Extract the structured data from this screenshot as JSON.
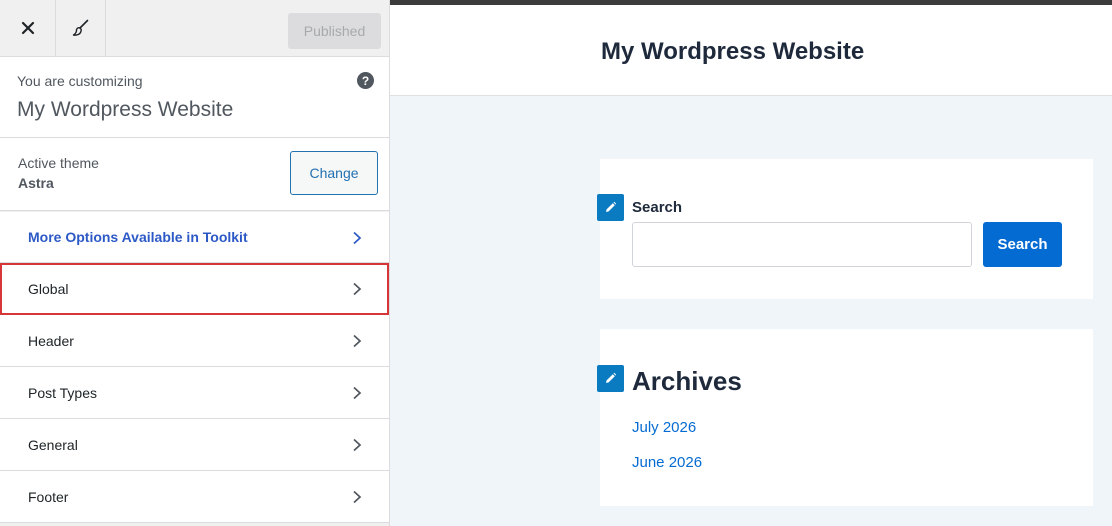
{
  "header": {
    "publish_label": "Published"
  },
  "info": {
    "label": "You are customizing",
    "site_title": "My Wordpress Website"
  },
  "theme": {
    "label": "Active theme",
    "name": "Astra",
    "change_label": "Change"
  },
  "panels": [
    {
      "label": "More Options Available in Toolkit"
    },
    {
      "label": "Global"
    },
    {
      "label": "Header"
    },
    {
      "label": "Post Types"
    },
    {
      "label": "General"
    },
    {
      "label": "Footer"
    }
  ],
  "preview": {
    "site_title": "My Wordpress Website",
    "search_widget": {
      "label": "Search",
      "input_value": "",
      "button_label": "Search"
    },
    "archives_widget": {
      "title": "Archives",
      "links": [
        "July 2026",
        "June 2026"
      ]
    }
  },
  "colors": {
    "accent": "#2271b1",
    "toolkit_link": "#2c59c6",
    "highlight": "#d63638",
    "preview_button": "#046bd2",
    "preview_bg": "#f0f5fa"
  },
  "icons": {
    "close": "close-icon",
    "brush": "brush-icon",
    "help": "help-icon",
    "chevron": "chevron-right-icon",
    "edit": "pencil-icon"
  }
}
